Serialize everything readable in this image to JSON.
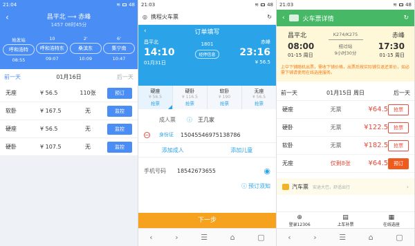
{
  "s1": {
    "status_time": "21:04",
    "status_batt": "48",
    "route": "昌平北 ⟶ 赤峰",
    "sub": "1457  08时45分",
    "stations": [
      {
        "n": "始发站",
        "b": "呼和浩特",
        "t": "08:55"
      },
      {
        "n": "10",
        "b": "呼和浩特东",
        "t": "09:07"
      },
      {
        "n": "2'",
        "b": "桑滨东",
        "t": "10:09"
      },
      {
        "n": "6'",
        "b": "集宁南",
        "t": "10:47"
      }
    ],
    "prev": "前一天",
    "date": "01月16日",
    "next": "后一天",
    "rows": [
      {
        "type": "无座",
        "price": "¥ 56.5",
        "count": "110张",
        "btn": "预订"
      },
      {
        "type": "软卧",
        "price": "¥ 167.5",
        "count": "无",
        "btn": "监控"
      },
      {
        "type": "硬座",
        "price": "¥ 56.5",
        "count": "无",
        "btn": "监控"
      },
      {
        "type": "硬卧",
        "price": "¥ 107.5",
        "count": "无",
        "btn": "监控"
      }
    ]
  },
  "s2": {
    "status_time": "21:03",
    "status_batt": "48",
    "url": "携程火车票",
    "title": "订单填写",
    "from": "昌平北",
    "dep": "14:10",
    "dep_date": "01月31日",
    "train": "1801",
    "tag": "经停信息",
    "to": "赤峰",
    "arr": "23:16",
    "arr_price": "¥ 56.5",
    "seats": [
      {
        "n": "硬座",
        "p": "¥ 56.5",
        "g": "抢票"
      },
      {
        "n": "硬卧",
        "p": "¥ 116.5",
        "g": "抢票"
      },
      {
        "n": "软卧",
        "p": "¥ 190",
        "g": "抢票"
      },
      {
        "n": "无座",
        "p": "¥ 56.5",
        "g": "抢票"
      }
    ],
    "adult_label": "成人票",
    "name": "王几家",
    "id_type": "身份证",
    "id_no": "15045546975138786",
    "add_adult": "添加成人",
    "add_child": "添加儿童",
    "phone_label": "手机号码",
    "phone": "18542673655",
    "notice": "预订须知",
    "next": "下一步"
  },
  "s3": {
    "status_time": "21:03",
    "status_batt": "48",
    "title": "火车票详情",
    "from": "昌平北",
    "dep": "08:00",
    "dep_date": "01-15 周日",
    "train": "K274/K275",
    "stop": "经过站",
    "dur": "9小时30分",
    "to": "赤峰",
    "arr": "17:30",
    "arr_date": "01-15 周日",
    "note": "上中下铺随机出票，需收下铺价格，出票后按实际铺位退还差价，如必需下铺请使用在线选座服务。",
    "prev": "前一天",
    "date": "01月15日 周日",
    "next": "后一天",
    "rows": [
      {
        "type": "硬座",
        "avail": "无票",
        "price": "¥64.5",
        "btn": "抢票",
        "solid": false
      },
      {
        "type": "硬卧",
        "avail": "无票",
        "price": "¥122.5",
        "btn": "抢票",
        "solid": false
      },
      {
        "type": "软卧",
        "avail": "无票",
        "price": "¥182.5",
        "btn": "抢票",
        "solid": false
      },
      {
        "type": "无座",
        "avail": "仅剩8张",
        "price": "¥64.5",
        "btn": "预订",
        "solid": true
      }
    ],
    "bus": "汽车票",
    "bus_sub": "安途大巴，舒适出行",
    "tabs": [
      "登录12306",
      "上车补票",
      "在线选座"
    ]
  }
}
